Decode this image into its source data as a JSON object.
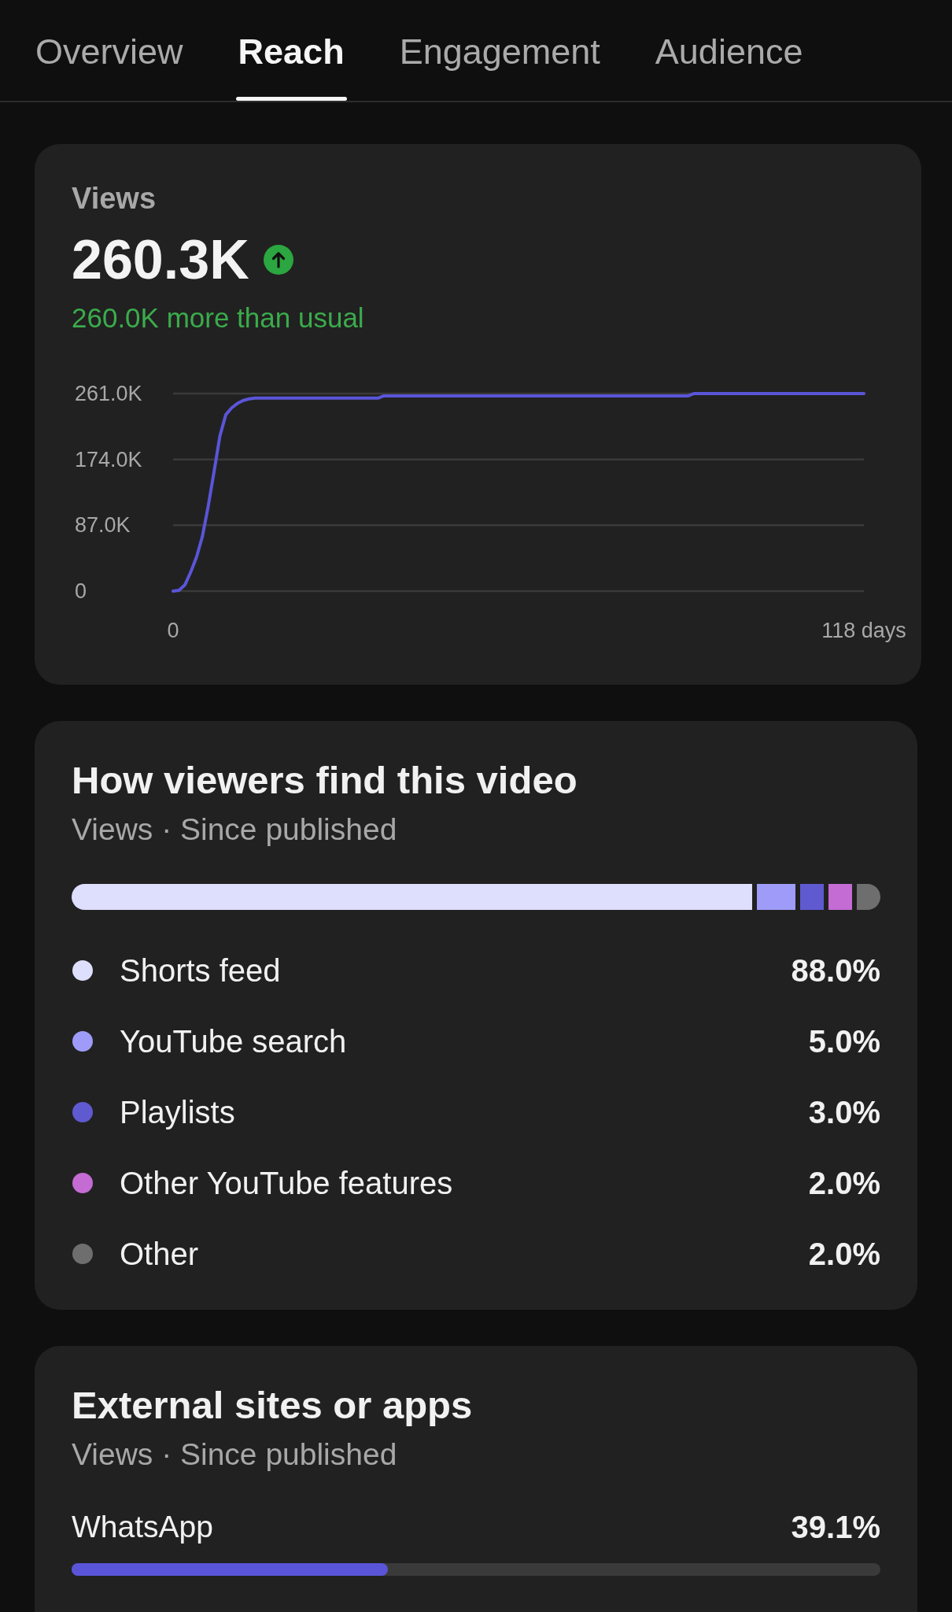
{
  "tabs": [
    {
      "label": "Overview",
      "selected": false
    },
    {
      "label": "Reach",
      "selected": true
    },
    {
      "label": "Engagement",
      "selected": false
    },
    {
      "label": "Audience",
      "selected": false
    }
  ],
  "views_card": {
    "label": "Views",
    "value": "260.3K",
    "increase": true,
    "comparison": "260.0K more than usual",
    "chart_data": {
      "type": "line",
      "x": [
        0,
        1,
        2,
        3,
        4,
        5,
        6,
        7,
        8,
        9,
        10,
        11,
        12,
        13,
        14,
        35,
        36,
        88,
        89,
        118
      ],
      "series": [
        {
          "color": "#5a55d8",
          "values": [
            0,
            1000,
            8000,
            25000,
            45000,
            72000,
            112000,
            158000,
            205000,
            233000,
            242000,
            248000,
            252000,
            254000,
            255000,
            255000,
            258000,
            258000,
            261000,
            261000
          ]
        }
      ],
      "xlim": [
        0,
        118
      ],
      "ylim": [
        0,
        261000
      ],
      "xticks": [
        {
          "value": 0,
          "label": "0"
        },
        {
          "value": 118,
          "label": "118 days"
        }
      ],
      "yticks": [
        {
          "value": 0,
          "label": "0"
        },
        {
          "value": 87000,
          "label": "87.0K"
        },
        {
          "value": 174000,
          "label": "174.0K"
        },
        {
          "value": 261000,
          "label": "261.0K"
        }
      ]
    }
  },
  "traffic_sources": {
    "title": "How viewers find this video",
    "subtitle": "Views · Since published",
    "sources": [
      {
        "label": "Shorts feed",
        "percent": "88.0%",
        "color": "#dedefd"
      },
      {
        "label": "YouTube search",
        "percent": "5.0%",
        "color": "#9e9cf8"
      },
      {
        "label": "Playlists",
        "percent": "3.0%",
        "color": "#5f5ad0"
      },
      {
        "label": "Other YouTube features",
        "percent": "2.0%",
        "color": "#c46bd4"
      },
      {
        "label": "Other",
        "percent": "2.0%",
        "color": "#6e6e6e"
      }
    ]
  },
  "external_sites": {
    "title": "External sites or apps",
    "subtitle": "Views · Since published",
    "sites": [
      {
        "label": "WhatsApp",
        "percent": "39.1%",
        "level": 0.391
      }
    ]
  }
}
